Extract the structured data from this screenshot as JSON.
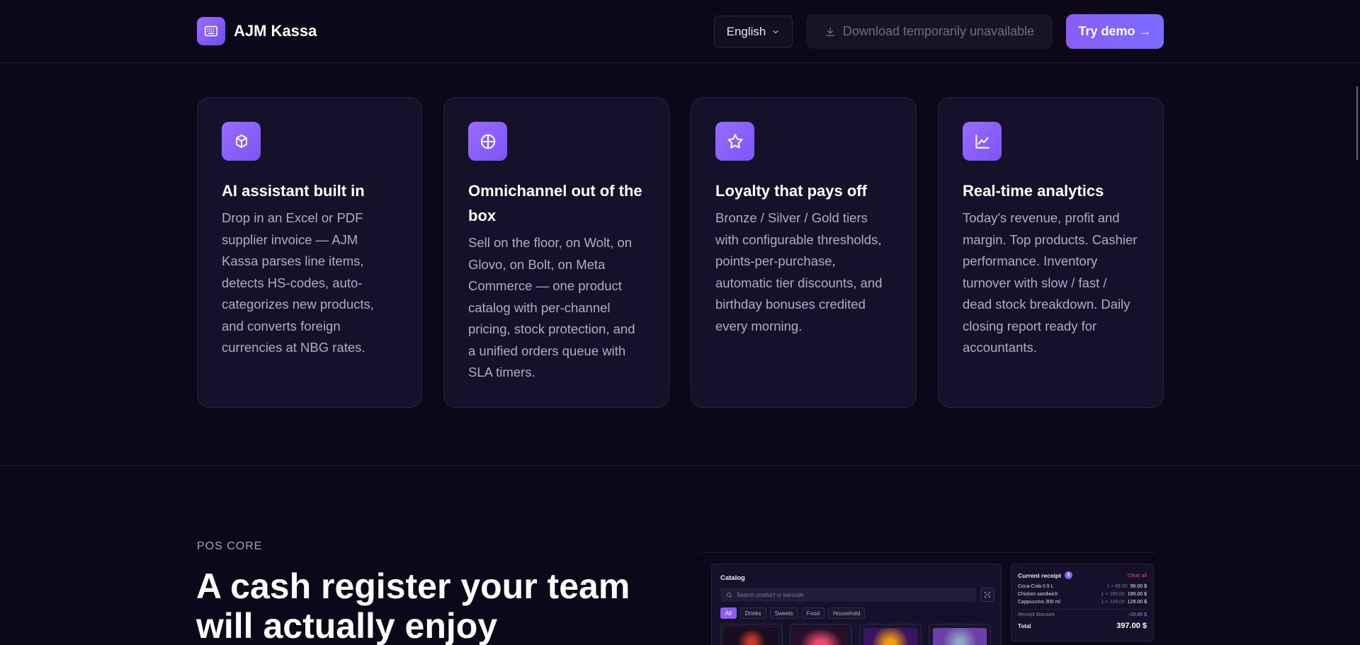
{
  "header": {
    "brand": "AJM Kassa",
    "language": "English",
    "download_label": "Download temporarily unavailable",
    "demo_label": "Try demo →"
  },
  "features": [
    {
      "icon": "cube-icon",
      "title": "AI assistant built in",
      "text": "Drop in an Excel or PDF supplier invoice — AJM Kassa parses line items, detects HS-codes, auto-categorizes new products, and converts foreign currencies at NBG rates."
    },
    {
      "icon": "crosshair-icon",
      "title": "Omnichannel out of the box",
      "text": "Sell on the floor, on Wolt, on Glovo, on Bolt, on Meta Commerce — one product catalog with per-channel pricing, stock protection, and a unified orders queue with SLA timers."
    },
    {
      "icon": "star-icon",
      "title": "Loyalty that pays off",
      "text": "Bronze / Silver / Gold tiers with configurable thresholds, points-per-purchase, automatic tier discounts, and birthday bonuses credited every morning."
    },
    {
      "icon": "line-chart-icon",
      "title": "Real-time analytics",
      "text": "Today's revenue, profit and margin. Top products. Cashier performance. Inventory turnover with slow / fast / dead stock breakdown. Daily closing report ready for accountants."
    }
  ],
  "pos_section": {
    "eyebrow": "POS CORE",
    "title": "A cash register your team will actually enjoy"
  },
  "preview": {
    "catalog_title": "Catalog",
    "search_placeholder": "Search product or barcode",
    "chips": [
      "All",
      "Drinks",
      "Sweets",
      "Food",
      "Household"
    ],
    "receipt": {
      "title": "Current receipt",
      "count": "3",
      "clear": "Clear all",
      "items": [
        {
          "name": "Coca-Cola 0.5 L",
          "qty": "1 × 99.00",
          "amount": "99.00 $"
        },
        {
          "name": "Chicken sandwich",
          "qty": "1 × 189.00",
          "amount": "189.00 $"
        },
        {
          "name": "Cappuccino 300 ml",
          "qty": "1 × 129.00",
          "amount": "129.00 $"
        }
      ],
      "discount_label": "Receipt discount",
      "discount_value": "−20.00 $",
      "total_label": "Total",
      "total_value": "397.00 $"
    }
  },
  "colors": {
    "background": "#0c0819",
    "card": "#15112a",
    "accent": "#8b5cf6",
    "muted_text": "#b1acc2"
  }
}
